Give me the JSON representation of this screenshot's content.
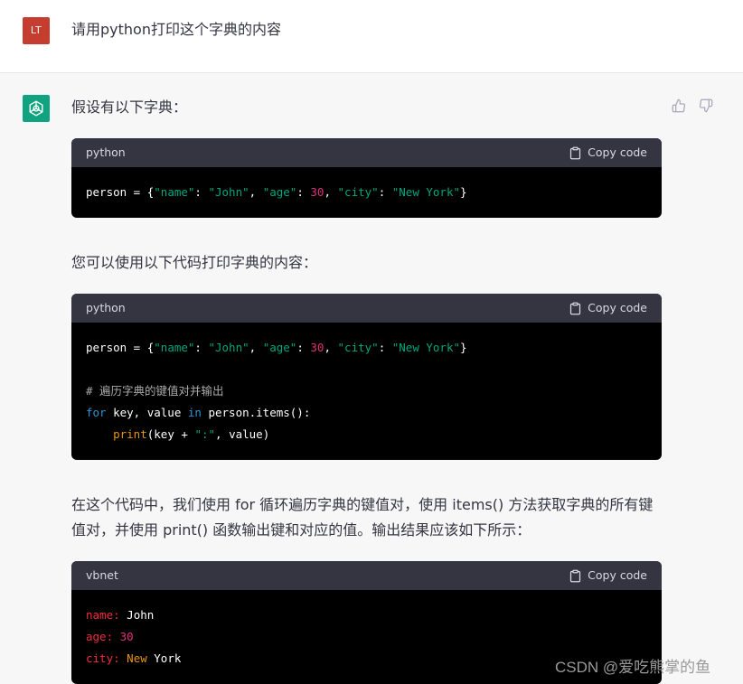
{
  "user_message": {
    "avatar_initials": "LT",
    "avatar_color": "#c43d2e",
    "text": "请用python打印这个字典的内容"
  },
  "assistant": {
    "avatar_icon": "openai-logo-icon",
    "avatar_color": "#10a37f",
    "intro": "假设有以下字典：",
    "middle": "您可以使用以下代码打印字典的内容：",
    "explanation_line1": "在这个代码中，我们使用 for 循环遍历字典的键值对，使用 items() 方法获取字典的所有键",
    "explanation_line2": "值对，并使用 print() 函数输出键和对应的值。输出结果应该如下所示：",
    "feedback_icons": [
      "thumbs-up-icon",
      "thumbs-down-icon"
    ]
  },
  "code_blocks": [
    {
      "language": "python",
      "copy_label": "Copy code",
      "lines": [
        [
          "person = {",
          "\"name\"",
          ": ",
          "\"John\"",
          ", ",
          "\"age\"",
          ": ",
          "30",
          ", ",
          "\"city\"",
          ": ",
          "\"New York\"",
          "}"
        ]
      ]
    },
    {
      "language": "python",
      "copy_label": "Copy code",
      "line1": [
        "person = {",
        "\"name\"",
        ": ",
        "\"John\"",
        ", ",
        "\"age\"",
        ": ",
        "30",
        ", ",
        "\"city\"",
        ": ",
        "\"New York\"",
        "}"
      ],
      "comment": "# 遍历字典的键值对并输出",
      "line_for": [
        "for",
        " key, value ",
        "in",
        " person.items():"
      ],
      "line_print": [
        "    ",
        "print",
        "(key + ",
        "\":\"",
        ", value)"
      ]
    },
    {
      "language": "vbnet",
      "copy_label": "Copy code",
      "out1": [
        "name:",
        " John"
      ],
      "out2": [
        "age:",
        " 30"
      ],
      "out3": [
        "city:",
        " ",
        "New",
        " York"
      ]
    }
  ],
  "watermark": "CSDN @爱吃熊掌的鱼",
  "colors": {
    "string": "#00a67d",
    "number": "#df3079",
    "keyword": "#2e95d3",
    "builtin": "#f22c3d",
    "comment": "#a9aaab"
  }
}
